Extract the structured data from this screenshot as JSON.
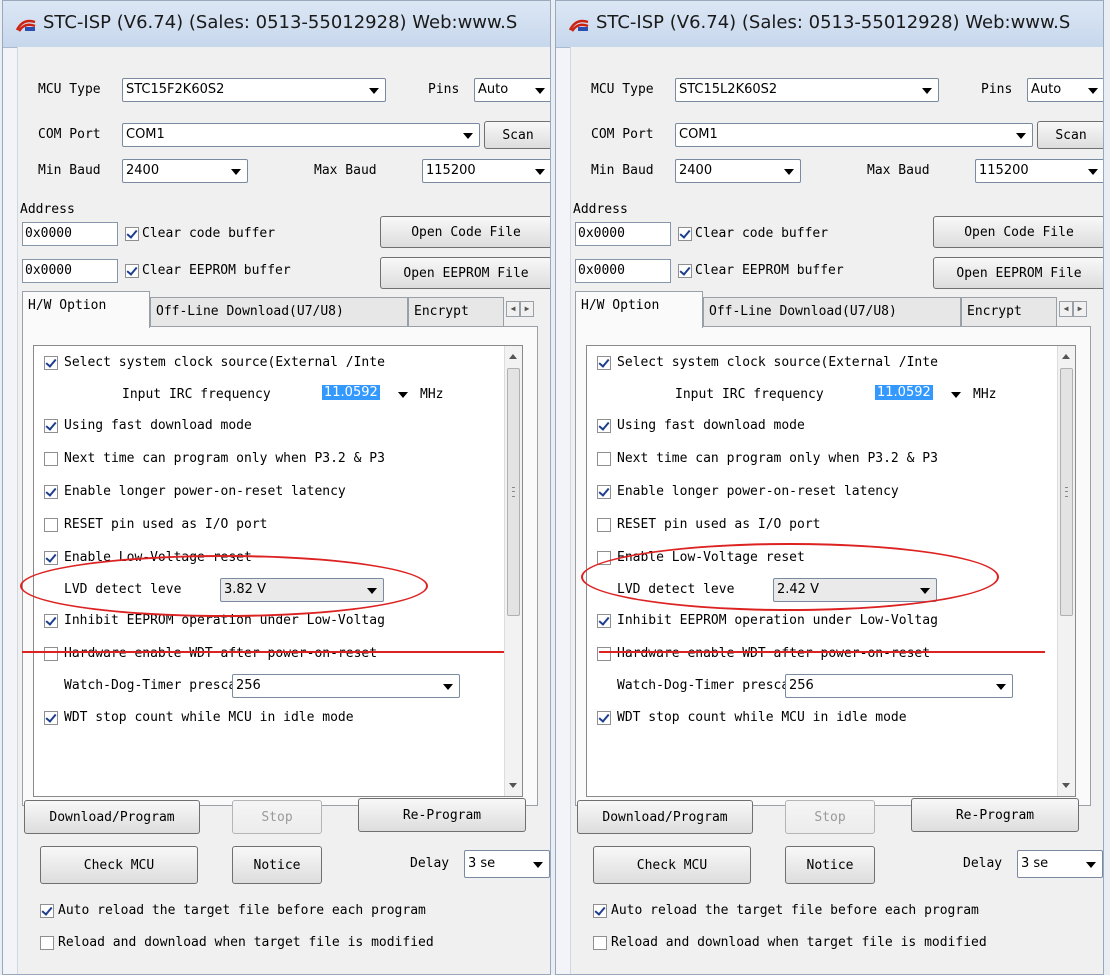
{
  "windows": [
    {
      "title": "STC-ISP (V6.74) (Sales: 0513-55012928) Web:www.S",
      "mcu_type_label": "MCU Type",
      "mcu_type_value": "STC15F2K60S2",
      "pins_label": "Pins",
      "pins_value": "Auto",
      "com_port_label": "COM Port",
      "com_port_value": "COM1",
      "scan_label": "Scan",
      "min_baud_label": "Min Baud",
      "min_baud_value": "2400",
      "max_baud_label": "Max Baud",
      "max_baud_value": "115200",
      "address_label": "Address",
      "code_address": "0x0000",
      "clear_code_label": "Clear code buffer",
      "clear_code_checked": true,
      "open_code_label": "Open Code File",
      "eeprom_address": "0x0000",
      "clear_eeprom_label": "Clear EEPROM buffer",
      "clear_eeprom_checked": true,
      "open_eeprom_label": "Open EEPROM File",
      "tabs": [
        "H/W Option",
        "Off-Line Download(U7/U8)",
        "Encrypt"
      ],
      "options": {
        "select_clock_label": "Select system clock source(External /Inte",
        "select_clock_checked": true,
        "irc_label": "Input IRC frequency",
        "irc_value": "11.0592",
        "irc_unit": "MHz",
        "fast_download_label": "Using fast download mode",
        "fast_download_checked": true,
        "next_time_label": "Next time can program only when P3.2 & P3",
        "next_time_checked": false,
        "longer_reset_label": "Enable longer power-on-reset latency",
        "longer_reset_checked": true,
        "reset_pin_label": "RESET pin used as I/O port",
        "reset_pin_checked": false,
        "low_voltage_label": "Enable Low-Voltage reset",
        "low_voltage_checked": true,
        "lvd_label": "LVD detect leve",
        "lvd_value": "3.82 V",
        "inhibit_eeprom_label": "Inhibit EEPROM operation under Low-Voltag",
        "inhibit_eeprom_checked": true,
        "hw_wdt_label": "Hardware enable WDT after power-on-reset",
        "hw_wdt_checked": false,
        "wdt_prescale_label": "Watch-Dog-Timer prescal",
        "wdt_prescale_value": "256",
        "wdt_stop_label": "WDT stop count while MCU in idle mode",
        "wdt_stop_checked": true
      },
      "download_label": "Download/Program",
      "stop_label": "Stop",
      "reprogram_label": "Re-Program",
      "check_mcu_label": "Check MCU",
      "notice_label": "Notice",
      "delay_label": "Delay",
      "delay_value": "3 se",
      "auto_reload_label": "Auto reload the target file before each program",
      "auto_reload_checked": true,
      "reload_modified_label": "Reload and download when target file is modified",
      "reload_modified_checked": false
    },
    {
      "title": "STC-ISP (V6.74) (Sales: 0513-55012928) Web:www.S",
      "mcu_type_label": "MCU Type",
      "mcu_type_value": "STC15L2K60S2",
      "pins_label": "Pins",
      "pins_value": "Auto",
      "com_port_label": "COM Port",
      "com_port_value": "COM1",
      "scan_label": "Scan",
      "min_baud_label": "Min Baud",
      "min_baud_value": "2400",
      "max_baud_label": "Max Baud",
      "max_baud_value": "115200",
      "address_label": "Address",
      "code_address": "0x0000",
      "clear_code_label": "Clear code buffer",
      "clear_code_checked": true,
      "open_code_label": "Open Code File",
      "eeprom_address": "0x0000",
      "clear_eeprom_label": "Clear EEPROM buffer",
      "clear_eeprom_checked": true,
      "open_eeprom_label": "Open EEPROM File",
      "tabs": [
        "H/W Option",
        "Off-Line Download(U7/U8)",
        "Encrypt"
      ],
      "options": {
        "select_clock_label": "Select system clock source(External /Inte",
        "select_clock_checked": true,
        "irc_label": "Input IRC frequency",
        "irc_value": "11.0592",
        "irc_unit": "MHz",
        "fast_download_label": "Using fast download mode",
        "fast_download_checked": true,
        "next_time_label": "Next time can program only when P3.2 & P3",
        "next_time_checked": false,
        "longer_reset_label": "Enable longer power-on-reset latency",
        "longer_reset_checked": true,
        "reset_pin_label": "RESET pin used as I/O port",
        "reset_pin_checked": false,
        "low_voltage_label": "Enable Low-Voltage reset",
        "low_voltage_checked": false,
        "lvd_label": "LVD detect leve",
        "lvd_value": "2.42 V",
        "inhibit_eeprom_label": "Inhibit EEPROM operation under Low-Voltag",
        "inhibit_eeprom_checked": true,
        "hw_wdt_label": "Hardware enable WDT after power-on-reset",
        "hw_wdt_checked": false,
        "wdt_prescale_label": "Watch-Dog-Timer prescal",
        "wdt_prescale_value": "256",
        "wdt_stop_label": "WDT stop count while MCU in idle mode",
        "wdt_stop_checked": true
      },
      "download_label": "Download/Program",
      "stop_label": "Stop",
      "reprogram_label": "Re-Program",
      "check_mcu_label": "Check MCU",
      "notice_label": "Notice",
      "delay_label": "Delay",
      "delay_value": "3 se",
      "auto_reload_label": "Auto reload the target file before each program",
      "auto_reload_checked": true,
      "reload_modified_label": "Reload and download when target file is modified",
      "reload_modified_checked": false
    }
  ],
  "colors": {
    "highlight_annotation": "#dd2222",
    "selection": "#3399ff",
    "title_bar": "#c7d7ec"
  },
  "icons": [
    "stc-app-icon",
    "dropdown-arrow-icon",
    "checkbox-check-icon",
    "scroll-up-icon",
    "scroll-down-icon",
    "tab-scroll-left-icon",
    "tab-scroll-right-icon"
  ]
}
